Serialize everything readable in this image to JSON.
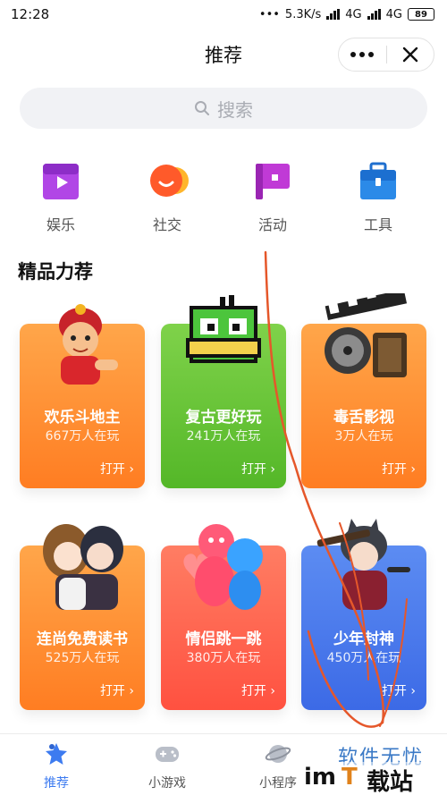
{
  "status": {
    "time": "12:28",
    "speed": "5.3K/s",
    "net1": "4G",
    "net2": "4G",
    "battery": "89"
  },
  "nav": {
    "title": "推荐"
  },
  "search": {
    "placeholder": "搜索"
  },
  "categories": [
    {
      "label": "娱乐",
      "icon": "play-icon",
      "color": "#b146e6"
    },
    {
      "label": "社交",
      "icon": "chat-bubble-icon",
      "color": "#ff5a2a"
    },
    {
      "label": "活动",
      "icon": "flag-icon",
      "color": "#c03ad6"
    },
    {
      "label": "工具",
      "icon": "toolbox-icon",
      "color": "#2b8ae8"
    }
  ],
  "section": {
    "title": "精品力荐"
  },
  "cards": [
    {
      "name": "欢乐斗地主",
      "players": "667万人在玩",
      "open": "打开 ›",
      "art": "cartoon-character-icon"
    },
    {
      "name": "复古更好玩",
      "players": "241万人在玩",
      "open": "打开 ›",
      "art": "pixel-duck-icon"
    },
    {
      "name": "毒舌影视",
      "players": "3万人在玩",
      "open": "打开 ›",
      "art": "film-clapper-icon"
    },
    {
      "name": "连尚免费读书",
      "players": "525万人在玩",
      "open": "打开 ›",
      "art": "anime-couple-icon"
    },
    {
      "name": "情侣跳一跳",
      "players": "380万人在玩",
      "open": "打开 ›",
      "art": "jelly-figures-icon"
    },
    {
      "name": "少年封神",
      "players": "450万人在玩",
      "open": "打开 ›",
      "art": "soldier-character-icon"
    }
  ],
  "tabs": [
    {
      "label": "推荐",
      "icon": "star-icon",
      "active": true
    },
    {
      "label": "小游戏",
      "icon": "gamepad-icon",
      "active": false
    },
    {
      "label": "小程序",
      "icon": "planet-icon",
      "active": false
    }
  ],
  "watermark": {
    "line1": "软件无忧",
    "p1": "im",
    "p2": "T",
    "p3": "载站"
  },
  "colors": {
    "accent": "#3d7bf0",
    "annotation": "#e5572a"
  }
}
